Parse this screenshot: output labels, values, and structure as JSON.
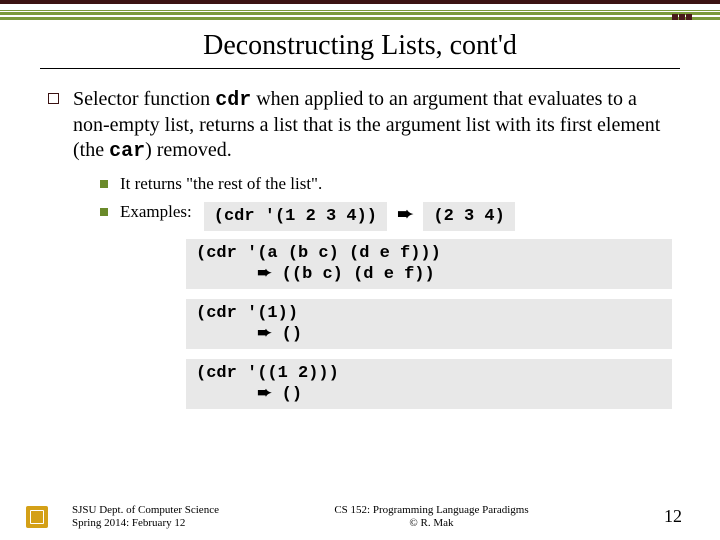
{
  "title": "Deconstructing Lists, cont'd",
  "bullet": {
    "pre": "Selector function ",
    "code1": "cdr",
    "mid": " when applied to an argument that evaluates to a non-empty list, returns a list that is the argument list with its first element (the ",
    "code2": "car",
    "post": ") removed."
  },
  "sub1": "It returns \"the rest of the list\".",
  "sub2_label": "Examples:",
  "ex1": {
    "input": "(cdr '(1 2 3 4))",
    "output": "(2 3 4)"
  },
  "ex2": {
    "input": "(cdr '(a (b c) (d e f)))",
    "output": "((b c) (d e f))",
    "arrow": "➨"
  },
  "ex3": {
    "input": "(cdr '(1))",
    "output": "()",
    "arrow": "➨"
  },
  "ex4": {
    "input": "(cdr '((1 2)))",
    "output": "()",
    "arrow": "➨"
  },
  "arrow": "➨",
  "footer": {
    "dept": "SJSU Dept. of Computer Science",
    "term": "Spring 2014: February 12",
    "course": "CS 152: Programming Language Paradigms",
    "author": "© R. Mak",
    "page": "12"
  }
}
